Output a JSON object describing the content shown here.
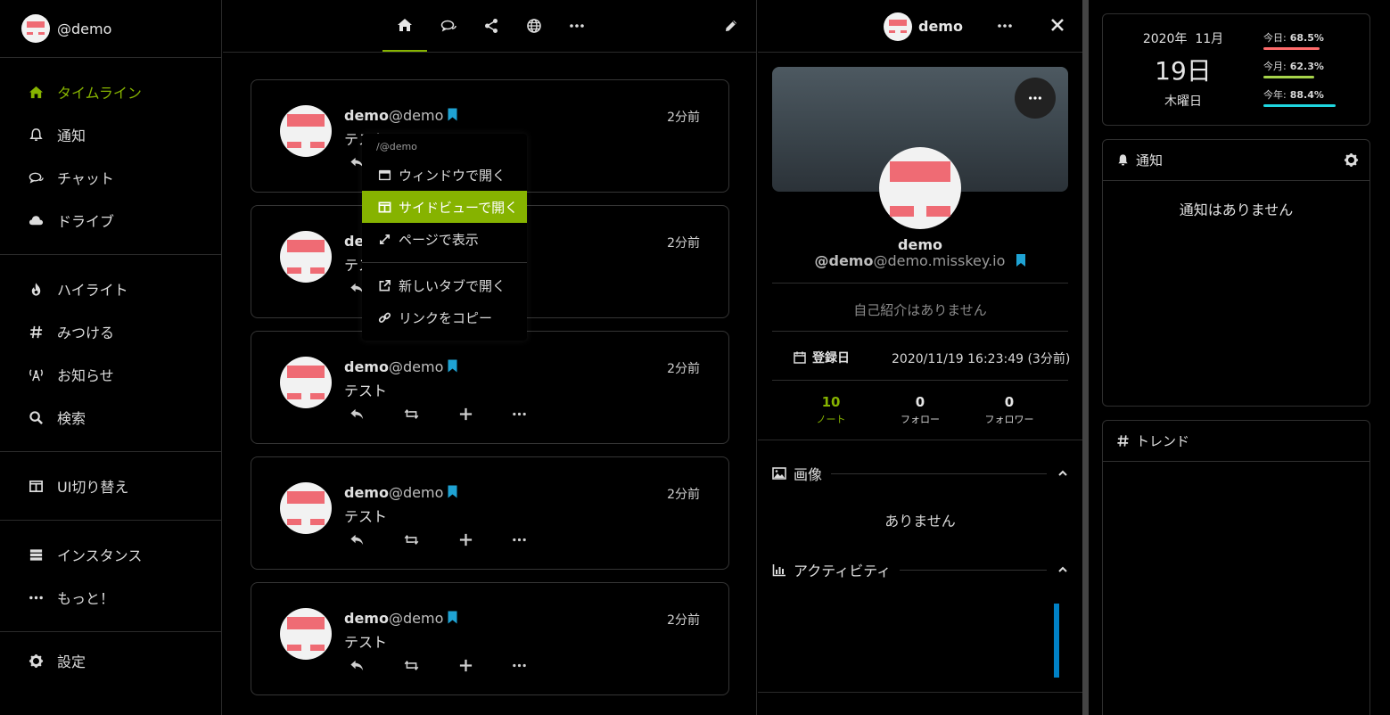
{
  "account": {
    "handle": "@demo"
  },
  "sidebar": {
    "items": [
      {
        "label": "タイムライン",
        "icon": "home-icon"
      },
      {
        "label": "通知",
        "icon": "bell-icon"
      },
      {
        "label": "チャット",
        "icon": "comments-icon"
      },
      {
        "label": "ドライブ",
        "icon": "cloud-icon"
      },
      {
        "label": "ハイライト",
        "icon": "fire-icon"
      },
      {
        "label": "みつける",
        "icon": "hashtag-icon"
      },
      {
        "label": "お知らせ",
        "icon": "broadcast-icon"
      },
      {
        "label": "検索",
        "icon": "search-icon"
      },
      {
        "label": "UI切り替え",
        "icon": "columns-icon"
      },
      {
        "label": "インスタンス",
        "icon": "server-icon"
      },
      {
        "label": "もっと！",
        "icon": "ellipsis-icon"
      },
      {
        "label": "設定",
        "icon": "gear-icon"
      }
    ]
  },
  "notes": [
    {
      "name": "demo",
      "username": "@demo",
      "time": "2分前",
      "text": "テスト"
    },
    {
      "name": "demo",
      "username": "@demo",
      "time": "2分前",
      "text": "テスト"
    },
    {
      "name": "demo",
      "username": "@demo",
      "time": "2分前",
      "text": "テスト"
    },
    {
      "name": "demo",
      "username": "@demo",
      "time": "2分前",
      "text": "テスト"
    },
    {
      "name": "demo",
      "username": "@demo",
      "time": "2分前",
      "text": "テスト"
    }
  ],
  "context_menu": {
    "title": "/@demo",
    "items": [
      "ウィンドウで開く",
      "サイドビューで開く",
      "ページで表示",
      "新しいタブで開く",
      "リンクをコピー"
    ]
  },
  "sideview": {
    "header_name": "demo",
    "name": "demo",
    "acct_user": "@demo",
    "acct_host": "@demo.misskey.io",
    "bio": "自己紹介はありません",
    "registered_label": "登録日",
    "registered_value": "2020/11/19 16:23:49 (3分前)",
    "stats": [
      {
        "value": "10",
        "label": "ノート"
      },
      {
        "value": "0",
        "label": "フォロー"
      },
      {
        "value": "0",
        "label": "フォロワー"
      }
    ],
    "images_title": "画像",
    "images_empty": "ありません",
    "activity_title": "アクティビティ"
  },
  "widgets": {
    "calendar": {
      "year_month": "2020年  11月",
      "day": "19日",
      "weekday": "木曜日",
      "bars": [
        {
          "label": "今日:",
          "value": "68.5%",
          "ratio": 0.685,
          "color": "#ff6b6b"
        },
        {
          "label": "今月:",
          "value": "62.3%",
          "ratio": 0.623,
          "color": "#a6d34a"
        },
        {
          "label": "今年:",
          "value": "88.4%",
          "ratio": 0.884,
          "color": "#1fd7e0"
        }
      ]
    },
    "notifications": {
      "title": "通知",
      "empty": "通知はありません"
    },
    "trends": {
      "title": "トレンド"
    }
  },
  "colors": {
    "accent": "#86b300",
    "bookmark": "#1fa3d4",
    "avatar_red": "#ef6b74"
  }
}
